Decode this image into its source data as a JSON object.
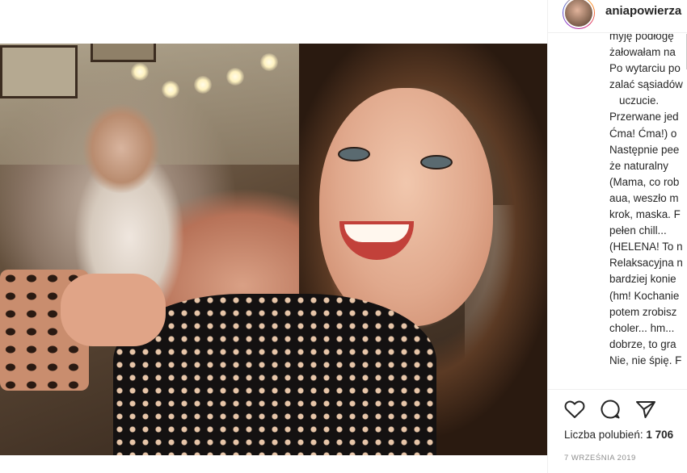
{
  "post": {
    "username": "aniapowierza",
    "caption_lines": [
      "myję podłogę",
      "żałowałam na",
      "Po wytarciu po",
      "zalać sąsiadów",
      "uczucie.",
      "Przerwane jed",
      "Ćma! Ćma!) o",
      "Następnie pee",
      "że naturalny",
      "(Mama, co rob",
      "aua, weszło m",
      "krok, maska. F",
      "pełen chill...",
      "(HELENA! To n",
      "Relaksacyjna n",
      "bardziej konie",
      "(hm! Kochanie",
      "potem zrobisz",
      "choler... hm...",
      "dobrze, to gra",
      "Nie, nie śpię. F"
    ],
    "likes_label": "Liczba polubień:",
    "likes_count": "1 706",
    "date": "7 WRZEŚNIA 2019"
  },
  "icons": {
    "like": "heart-icon",
    "comment": "comment-icon",
    "share": "share-icon"
  },
  "colors": {
    "text": "#262626",
    "muted": "#8e8e8e",
    "border": "#efefef"
  }
}
